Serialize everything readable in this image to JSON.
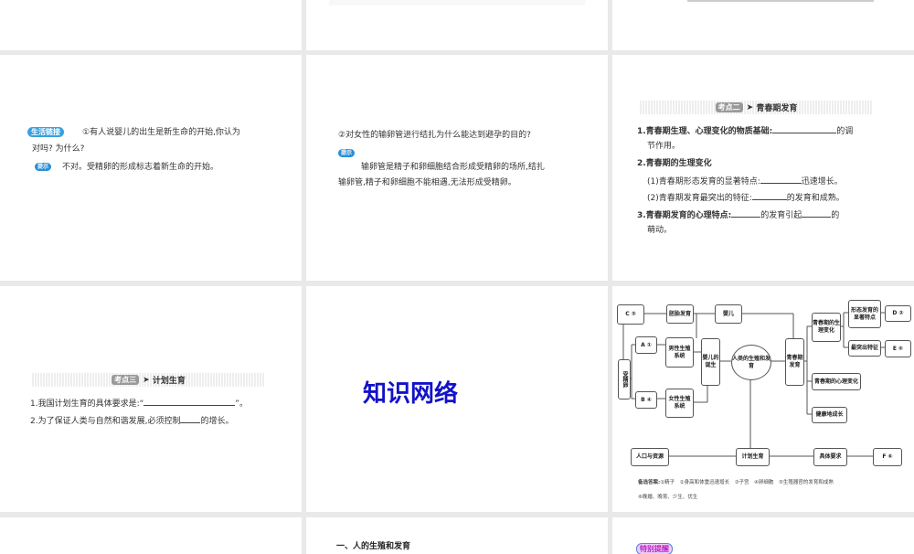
{
  "slides": {
    "s4": {
      "badge": "生活链接",
      "question_line1": "①有人说婴儿的出生是新生命的开始,你认为",
      "question_line2": "对吗? 为什么?",
      "hint_label": "提示",
      "answer": "不对。受精卵的形成标志着新生命的开始。"
    },
    "s5": {
      "question": "②对女性的输卵管进行结扎为什么能达到避孕的目的?",
      "hint_label": "提示",
      "answer_line1": "输卵管是精子和卵细胞结合形成受精卵的场所,结扎",
      "answer_line2": "输卵管,精子和卵细胞不能相遇,无法形成受精卵。"
    },
    "s6": {
      "tag": "考点二",
      "title": "青春期发育",
      "l1a": "1.青春期生理、心理变化的物质基础:",
      "l1b": "的调",
      "l1c": "节作用。",
      "l2": "2.青春期的生理变化",
      "l3a": "(1)青春期形态发育的显著特点:",
      "l3b": "迅速增长。",
      "l4a": "(2)青春期发育最突出的特征:",
      "l4b": "的发育和成熟。",
      "l5a": "3.青春期发育的心理特点:",
      "l5b": "的发育引起",
      "l5c": "的",
      "l6": "萌动。"
    },
    "s7": {
      "tag": "考点三",
      "title": "计划生育",
      "l1a": "1.我国计划生育的具体要求是:“",
      "l1b": "”。",
      "l2a": "2.为了保证人类与自然和谐发展,必须控制",
      "l2b": "的增长。"
    },
    "s8": {
      "title": "知识网络",
      "color": "#1212c8"
    },
    "s9": {
      "nodes": {
        "c": "C ③",
        "embryo": "胚胎发育",
        "baby": "婴儿",
        "zygote": "受精卵",
        "a": "A ①",
        "male": "男性生殖系统",
        "birth": "婴儿的诞生",
        "center": "人类的生殖和发育",
        "puberty": "青春期发育",
        "b": "B ④",
        "female": "女性生殖系统",
        "phys": "青春期的生理变化",
        "morph": "形态发育的显著特点",
        "d": "D ②",
        "prominent": "最突出特征",
        "e": "E ⑤",
        "psych": "青春期的心理变化",
        "healthy": "健康地成长",
        "population": "人口与资源",
        "planning": "计划生育",
        "req": "具体要求",
        "f": "F ⑥"
      },
      "options_label": "备选答案:",
      "options_line1": "①精子　②身高和体重迅速增长　③子宫　④卵细胞　⑤生殖器官的发育和成熟",
      "options_line2": "⑥晚婚、晚育、少生、优生"
    },
    "s11": {
      "heading": "一、人的生殖和发育"
    },
    "s12": {
      "badge": "特别提醒"
    }
  }
}
